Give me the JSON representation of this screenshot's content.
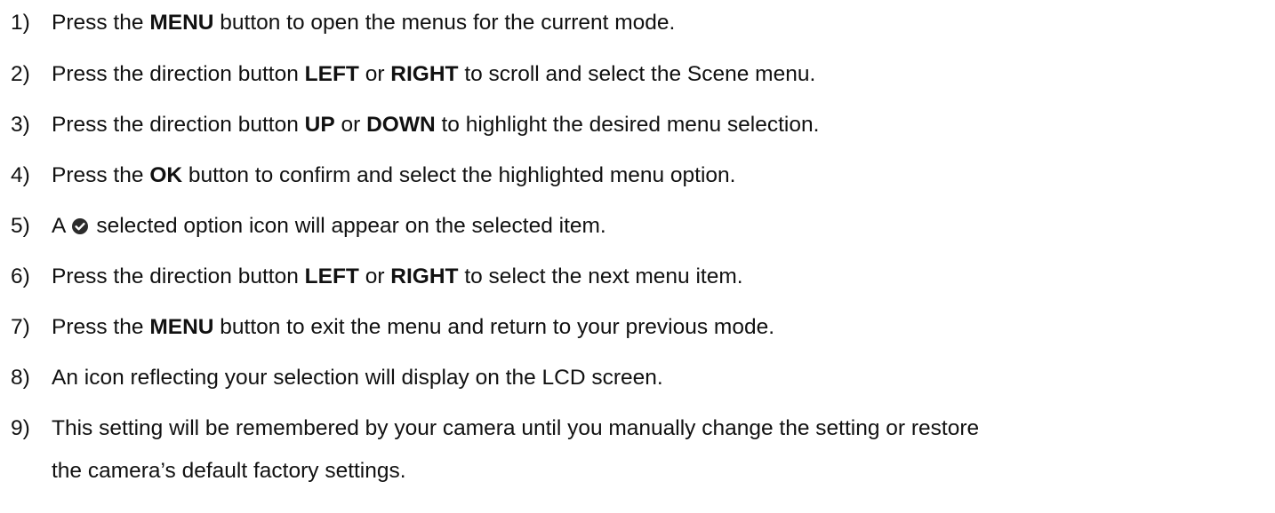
{
  "steps": [
    {
      "number": "1)",
      "segments": [
        {
          "t": "Press the ",
          "b": false
        },
        {
          "t": "MENU",
          "b": true
        },
        {
          "t": " button to open the menus for the current mode.",
          "b": false
        }
      ]
    },
    {
      "number": "2)",
      "segments": [
        {
          "t": "Press the direction button ",
          "b": false
        },
        {
          "t": "LEFT",
          "b": true
        },
        {
          "t": " or ",
          "b": false
        },
        {
          "t": "RIGHT",
          "b": true
        },
        {
          "t": " to scroll and select the Scene menu.",
          "b": false
        }
      ]
    },
    {
      "number": "3)",
      "segments": [
        {
          "t": "Press the direction button ",
          "b": false
        },
        {
          "t": "UP",
          "b": true
        },
        {
          "t": " or ",
          "b": false
        },
        {
          "t": "DOWN",
          "b": true
        },
        {
          "t": " to highlight the desired menu selection.",
          "b": false
        }
      ]
    },
    {
      "number": "4)",
      "segments": [
        {
          "t": "Press the ",
          "b": false
        },
        {
          "t": "OK",
          "b": true
        },
        {
          "t": " button to confirm and select the highlighted menu option.",
          "b": false
        }
      ]
    },
    {
      "number": "5)",
      "pre": "A",
      "icon": "selected-option-check-icon",
      "post": "selected option icon will appear on the selected item."
    },
    {
      "number": "6)",
      "segments": [
        {
          "t": "Press the direction button ",
          "b": false
        },
        {
          "t": "LEFT",
          "b": true
        },
        {
          "t": " or ",
          "b": false
        },
        {
          "t": "RIGHT",
          "b": true
        },
        {
          "t": " to select the next menu item.",
          "b": false
        }
      ]
    },
    {
      "number": "7)",
      "segments": [
        {
          "t": "Press the ",
          "b": false
        },
        {
          "t": "MENU",
          "b": true
        },
        {
          "t": " button to exit the menu and return to your previous mode.",
          "b": false
        }
      ]
    },
    {
      "number": "8)",
      "segments": [
        {
          "t": "An icon reflecting your selection will display on the LCD screen.",
          "b": false
        }
      ]
    },
    {
      "number": "9)",
      "line1": "This setting will be remembered by your camera until you manually change the setting or restore",
      "line2": "the camera’s default factory settings."
    }
  ]
}
